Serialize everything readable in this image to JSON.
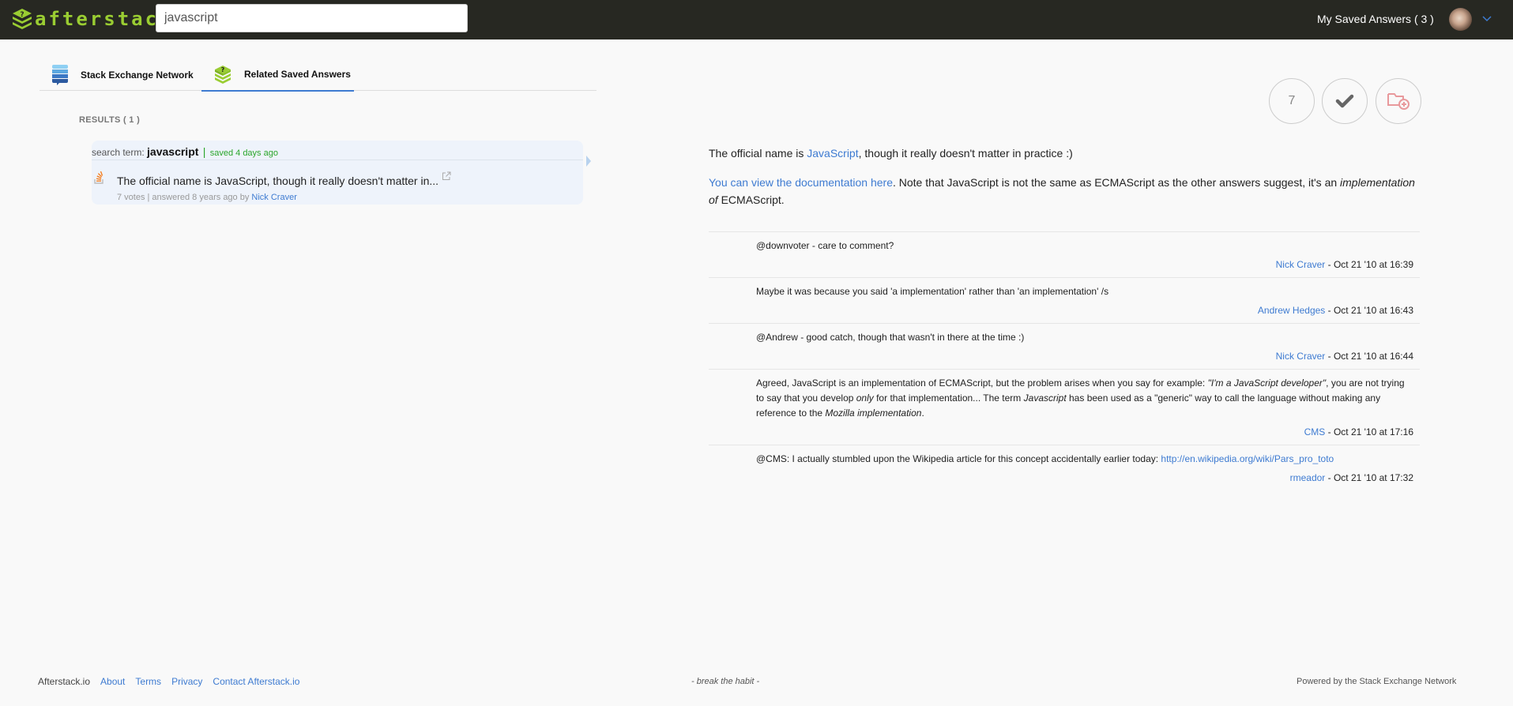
{
  "header": {
    "logo_text": "afterstack",
    "search_value": "javascript",
    "saved_answers_label": "My Saved Answers ( 3 )"
  },
  "tabs": [
    {
      "label": "Stack Exchange Network",
      "icon": "stack-exchange-icon",
      "active": false
    },
    {
      "label": "Related Saved Answers",
      "icon": "afterstack-question-icon",
      "active": true
    }
  ],
  "results": {
    "label": "RESULTS ( 1 )",
    "items": [
      {
        "search_term_prefix": "search term:",
        "search_term": "javascript",
        "separator": "|",
        "saved": "saved 4 days ago",
        "title": "The official name is JavaScript, though it really doesn't matter in...",
        "meta_prefix": "7 votes | answered 8 years ago by",
        "author": "Nick Craver",
        "site_icon": "stackoverflow-icon"
      }
    ]
  },
  "answer": {
    "vote_count": "7",
    "accepted": true,
    "p1_before": "The official name is ",
    "p1_link": "JavaScript",
    "p1_after": ", though it really doesn't matter in practice :)",
    "p2_link": "You can view the documentation here",
    "p2_after": ". Note that JavaScript is not the same as ECMAScript as the other answers suggest, it's an ",
    "p2_em": "implementation of",
    "p2_end": " ECMAScript."
  },
  "comments": [
    {
      "text": "@downvoter - care to comment?",
      "author": "Nick Craver",
      "date": " - Oct 21 '10 at 16:39"
    },
    {
      "text": "Maybe it was because you said 'a implementation' rather than 'an implementation' /s",
      "author": "Andrew Hedges",
      "date": " - Oct 21 '10 at 16:43"
    },
    {
      "text": "@Andrew - good catch, though that wasn't in there at the time :)",
      "author": "Nick Craver",
      "date": " - Oct 21 '10 at 16:44"
    },
    {
      "parts": {
        "a": "Agreed, JavaScript is an implementation of ECMAScript, but the problem arises when you say for example: ",
        "a_em": "\"I'm a JavaScript developer\"",
        "b": ", you are not trying to say that you develop ",
        "b_em": "only",
        "c": " for that implementation... The term ",
        "c_em": "Javascript",
        "d": " has been used as a \"generic\" way to call the language without making any reference to the ",
        "d_em": "Mozilla implementation",
        "e": "."
      },
      "author": "CMS",
      "date": " - Oct 21 '10 at 17:16"
    },
    {
      "text": "@CMS: I actually stumbled upon the Wikipedia article for this concept accidentally earlier today: ",
      "link": "http://en.wikipedia.org/wiki/Pars_pro_toto",
      "author": "rmeador",
      "date": " - Oct 21 '10 at 17:32"
    }
  ],
  "footer": {
    "brand": "Afterstack.io",
    "links": [
      "About",
      "Terms",
      "Privacy",
      "Contact Afterstack.io"
    ],
    "tagline": "- break the habit -",
    "powered_by": "Powered by the Stack Exchange Network"
  }
}
